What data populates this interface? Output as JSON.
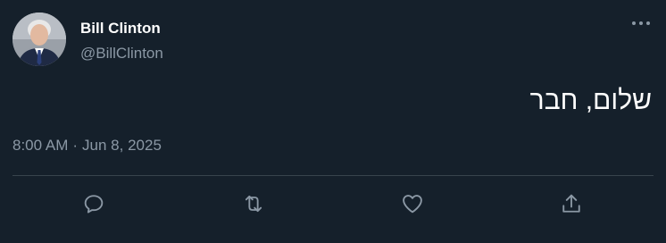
{
  "user": {
    "display_name": "Bill Clinton",
    "handle": "@BillClinton",
    "avatar_icon": "profile-photo"
  },
  "tweet": {
    "text": "שלום, חבר",
    "time": "8:00 AM",
    "separator": "·",
    "date": "Jun 8, 2025"
  },
  "actions": [
    {
      "name": "reply",
      "icon": "comment-icon"
    },
    {
      "name": "retweet",
      "icon": "retweet-icon"
    },
    {
      "name": "like",
      "icon": "heart-icon"
    },
    {
      "name": "share",
      "icon": "share-icon"
    }
  ],
  "colors": {
    "background": "#15202b",
    "primary_text": "#ffffff",
    "secondary_text": "#8b98a5",
    "divider": "#38444d"
  }
}
